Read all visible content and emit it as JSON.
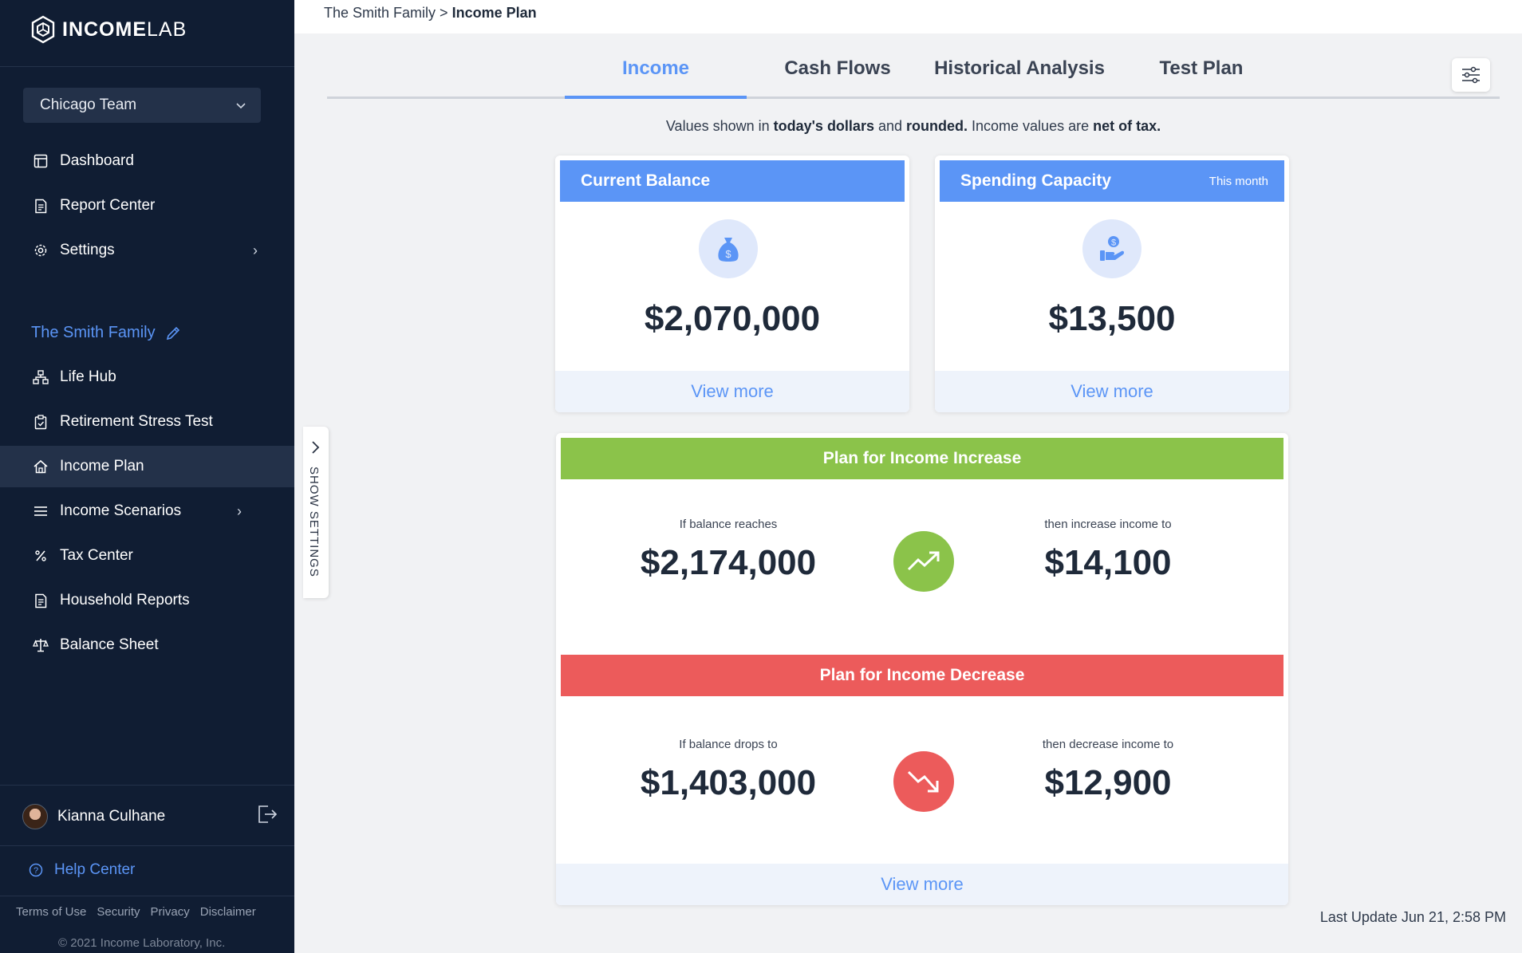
{
  "app": {
    "logo_bold": "INCOME",
    "logo_light": "LAB"
  },
  "sidebar": {
    "team_select": "Chicago Team",
    "nav": [
      {
        "label": "Dashboard",
        "icon": "layout-icon"
      },
      {
        "label": "Report Center",
        "icon": "document-icon"
      },
      {
        "label": "Settings",
        "icon": "gear-icon"
      }
    ],
    "family_title": "The Smith Family",
    "family_nav": [
      {
        "label": "Life Hub",
        "icon": "hierarchy-icon"
      },
      {
        "label": "Retirement Stress Test",
        "icon": "clipboard-icon"
      },
      {
        "label": "Income Plan",
        "icon": "home-icon",
        "active": true
      },
      {
        "label": "Income Scenarios",
        "icon": "list-icon"
      },
      {
        "label": "Tax Center",
        "icon": "percent-icon"
      },
      {
        "label": "Household Reports",
        "icon": "document-icon"
      },
      {
        "label": "Balance Sheet",
        "icon": "scale-icon"
      }
    ],
    "user_name": "Kianna Culhane",
    "help_center": "Help Center",
    "footer_links": [
      "Terms of Use",
      "Security",
      "Privacy",
      "Disclaimer"
    ],
    "copyright": "2021 Income Laboratory, Inc."
  },
  "settings_tab": {
    "label": "SHOW SETTINGS"
  },
  "breadcrumb": {
    "parent": "The Smith Family",
    "separator": ">",
    "current": "Income Plan"
  },
  "tabs": [
    {
      "label": "Income",
      "active": true
    },
    {
      "label": "Cash Flows"
    },
    {
      "label": "Historical Analysis"
    },
    {
      "label": "Test Plan"
    }
  ],
  "note": {
    "part1": "Values shown in ",
    "bold1": "today's dollars",
    "part2": " and ",
    "bold2": "rounded.",
    "part3": " Income values are ",
    "bold3": "net of tax."
  },
  "current_balance": {
    "title": "Current Balance",
    "value": "$2,070,000",
    "view_more": "View more"
  },
  "spending_capacity": {
    "title": "Spending Capacity",
    "subtitle": "This month",
    "value": "$13,500",
    "view_more": "View more"
  },
  "plan_increase": {
    "title": "Plan for Income Increase",
    "left_caption": "If balance reaches",
    "left_value": "$2,174,000",
    "right_caption": "then increase income to",
    "right_value": "$14,100",
    "color": "#8bc34a"
  },
  "plan_decrease": {
    "title": "Plan for Income Decrease",
    "left_caption": "If balance drops to",
    "left_value": "$1,403,000",
    "right_caption": "then decrease income to",
    "right_value": "$12,900",
    "color": "#ec5b5b",
    "view_more": "View more"
  },
  "last_update": "Last Update Jun 21, 2:58 PM",
  "colors": {
    "sidebar_bg": "#101d33",
    "accent_blue": "#5b95f6",
    "increase_green": "#8bc34a",
    "decrease_red": "#ec5b5b"
  }
}
